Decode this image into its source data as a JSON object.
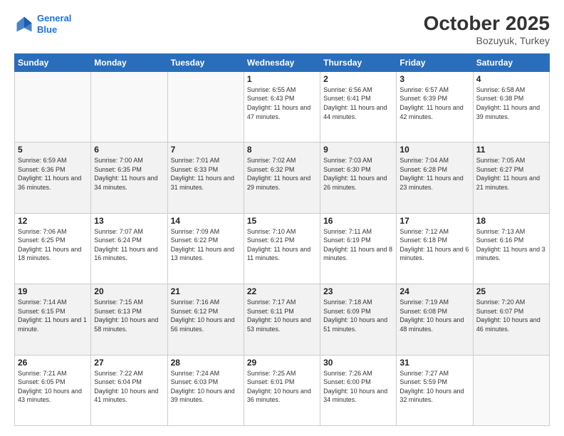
{
  "header": {
    "logo_line1": "General",
    "logo_line2": "Blue",
    "month": "October 2025",
    "location": "Bozuyuk, Turkey"
  },
  "weekdays": [
    "Sunday",
    "Monday",
    "Tuesday",
    "Wednesday",
    "Thursday",
    "Friday",
    "Saturday"
  ],
  "weeks": [
    [
      {
        "day": "",
        "info": ""
      },
      {
        "day": "",
        "info": ""
      },
      {
        "day": "",
        "info": ""
      },
      {
        "day": "1",
        "info": "Sunrise: 6:55 AM\nSunset: 6:43 PM\nDaylight: 11 hours and 47 minutes."
      },
      {
        "day": "2",
        "info": "Sunrise: 6:56 AM\nSunset: 6:41 PM\nDaylight: 11 hours and 44 minutes."
      },
      {
        "day": "3",
        "info": "Sunrise: 6:57 AM\nSunset: 6:39 PM\nDaylight: 11 hours and 42 minutes."
      },
      {
        "day": "4",
        "info": "Sunrise: 6:58 AM\nSunset: 6:38 PM\nDaylight: 11 hours and 39 minutes."
      }
    ],
    [
      {
        "day": "5",
        "info": "Sunrise: 6:59 AM\nSunset: 6:36 PM\nDaylight: 11 hours and 36 minutes."
      },
      {
        "day": "6",
        "info": "Sunrise: 7:00 AM\nSunset: 6:35 PM\nDaylight: 11 hours and 34 minutes."
      },
      {
        "day": "7",
        "info": "Sunrise: 7:01 AM\nSunset: 6:33 PM\nDaylight: 11 hours and 31 minutes."
      },
      {
        "day": "8",
        "info": "Sunrise: 7:02 AM\nSunset: 6:32 PM\nDaylight: 11 hours and 29 minutes."
      },
      {
        "day": "9",
        "info": "Sunrise: 7:03 AM\nSunset: 6:30 PM\nDaylight: 11 hours and 26 minutes."
      },
      {
        "day": "10",
        "info": "Sunrise: 7:04 AM\nSunset: 6:28 PM\nDaylight: 11 hours and 23 minutes."
      },
      {
        "day": "11",
        "info": "Sunrise: 7:05 AM\nSunset: 6:27 PM\nDaylight: 11 hours and 21 minutes."
      }
    ],
    [
      {
        "day": "12",
        "info": "Sunrise: 7:06 AM\nSunset: 6:25 PM\nDaylight: 11 hours and 18 minutes."
      },
      {
        "day": "13",
        "info": "Sunrise: 7:07 AM\nSunset: 6:24 PM\nDaylight: 11 hours and 16 minutes."
      },
      {
        "day": "14",
        "info": "Sunrise: 7:09 AM\nSunset: 6:22 PM\nDaylight: 11 hours and 13 minutes."
      },
      {
        "day": "15",
        "info": "Sunrise: 7:10 AM\nSunset: 6:21 PM\nDaylight: 11 hours and 11 minutes."
      },
      {
        "day": "16",
        "info": "Sunrise: 7:11 AM\nSunset: 6:19 PM\nDaylight: 11 hours and 8 minutes."
      },
      {
        "day": "17",
        "info": "Sunrise: 7:12 AM\nSunset: 6:18 PM\nDaylight: 11 hours and 6 minutes."
      },
      {
        "day": "18",
        "info": "Sunrise: 7:13 AM\nSunset: 6:16 PM\nDaylight: 11 hours and 3 minutes."
      }
    ],
    [
      {
        "day": "19",
        "info": "Sunrise: 7:14 AM\nSunset: 6:15 PM\nDaylight: 11 hours and 1 minute."
      },
      {
        "day": "20",
        "info": "Sunrise: 7:15 AM\nSunset: 6:13 PM\nDaylight: 10 hours and 58 minutes."
      },
      {
        "day": "21",
        "info": "Sunrise: 7:16 AM\nSunset: 6:12 PM\nDaylight: 10 hours and 56 minutes."
      },
      {
        "day": "22",
        "info": "Sunrise: 7:17 AM\nSunset: 6:11 PM\nDaylight: 10 hours and 53 minutes."
      },
      {
        "day": "23",
        "info": "Sunrise: 7:18 AM\nSunset: 6:09 PM\nDaylight: 10 hours and 51 minutes."
      },
      {
        "day": "24",
        "info": "Sunrise: 7:19 AM\nSunset: 6:08 PM\nDaylight: 10 hours and 48 minutes."
      },
      {
        "day": "25",
        "info": "Sunrise: 7:20 AM\nSunset: 6:07 PM\nDaylight: 10 hours and 46 minutes."
      }
    ],
    [
      {
        "day": "26",
        "info": "Sunrise: 7:21 AM\nSunset: 6:05 PM\nDaylight: 10 hours and 43 minutes."
      },
      {
        "day": "27",
        "info": "Sunrise: 7:22 AM\nSunset: 6:04 PM\nDaylight: 10 hours and 41 minutes."
      },
      {
        "day": "28",
        "info": "Sunrise: 7:24 AM\nSunset: 6:03 PM\nDaylight: 10 hours and 39 minutes."
      },
      {
        "day": "29",
        "info": "Sunrise: 7:25 AM\nSunset: 6:01 PM\nDaylight: 10 hours and 36 minutes."
      },
      {
        "day": "30",
        "info": "Sunrise: 7:26 AM\nSunset: 6:00 PM\nDaylight: 10 hours and 34 minutes."
      },
      {
        "day": "31",
        "info": "Sunrise: 7:27 AM\nSunset: 5:59 PM\nDaylight: 10 hours and 32 minutes."
      },
      {
        "day": "",
        "info": ""
      }
    ]
  ]
}
